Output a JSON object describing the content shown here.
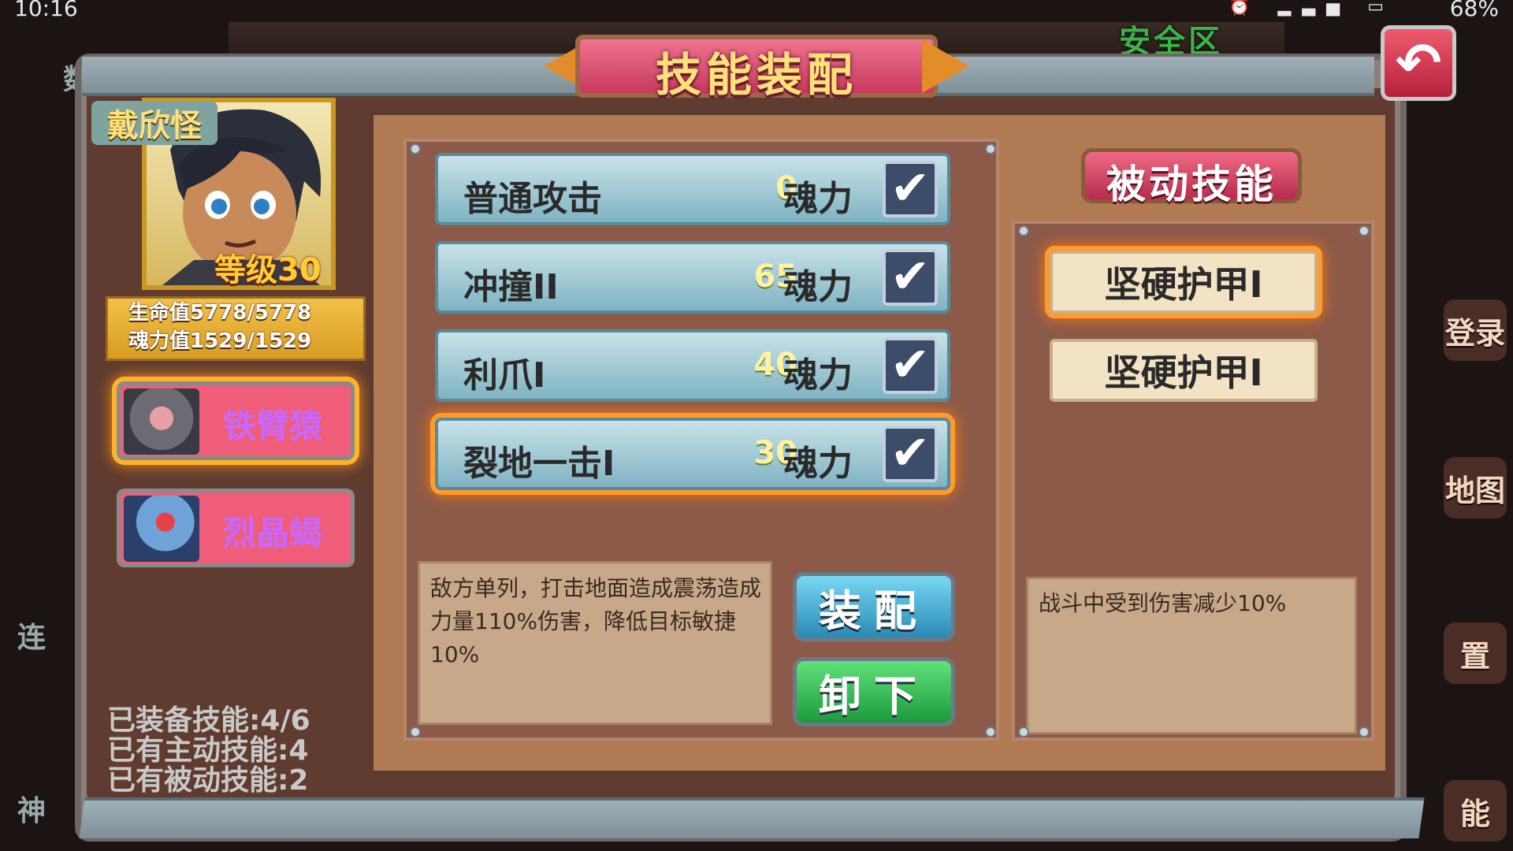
{
  "status_bar": {
    "time": "10:16",
    "battery": "68%",
    "icons": "⏰ ▂▃▅ ▭"
  },
  "background": {
    "safe_zone": "安全区",
    "side_labels": [
      "登录",
      "地图",
      "置",
      "能"
    ],
    "left_labels": [
      "数",
      "连",
      "神"
    ]
  },
  "header": {
    "title": "技能装配",
    "back_icon": "↶"
  },
  "hero": {
    "name": "戴欣怪",
    "level": "等级30",
    "hp": "生命值5778/5778",
    "mp": "魂力值1529/1529"
  },
  "pets": [
    {
      "name": "铁臂猿",
      "selected": true
    },
    {
      "name": "烈晶蝎",
      "selected": false
    }
  ],
  "counters": {
    "equipped": "已装备技能:4/6",
    "active": "已有主动技能:4",
    "passive": "已有被动技能:2"
  },
  "skills": [
    {
      "name": "普通攻击",
      "cost": "0",
      "unit": "魂力",
      "checked": true,
      "selected": false
    },
    {
      "name": "冲撞II",
      "cost": "65",
      "unit": "魂力",
      "checked": true,
      "selected": false
    },
    {
      "name": "利爪I",
      "cost": "40",
      "unit": "魂力",
      "checked": true,
      "selected": false
    },
    {
      "name": "裂地一击I",
      "cost": "30",
      "unit": "魂力",
      "checked": true,
      "selected": true
    }
  ],
  "check_glyph": "✔",
  "skill_description": "敌方单列，打击地面造成震荡造成力量110%伤害，降低目标敏捷10%",
  "buttons": {
    "equip": "装配",
    "unload": "卸下"
  },
  "passive": {
    "title": "被动技能",
    "items": [
      {
        "name": "坚硬护甲I",
        "selected": true
      },
      {
        "name": "坚硬护甲I",
        "selected": false
      }
    ],
    "description": "战斗中受到伤害减少10%"
  },
  "colors": {
    "accent_gold": "#ffe07a",
    "title_pink": "#e04d6f",
    "selection_glow": "#ff9a2b",
    "pet_name_purple": "#c768ff"
  }
}
